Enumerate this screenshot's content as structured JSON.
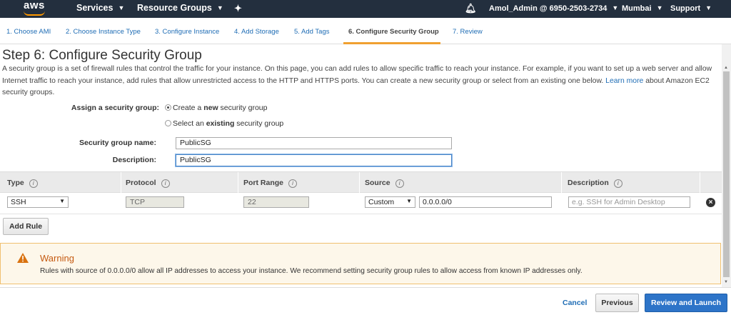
{
  "nav": {
    "logo": "aws",
    "services": "Services",
    "resource_groups": "Resource Groups",
    "account": "Amol_Admin @ 6950-2503-2734",
    "region": "Mumbai",
    "support": "Support"
  },
  "steps": [
    {
      "label": "1. Choose AMI"
    },
    {
      "label": "2. Choose Instance Type"
    },
    {
      "label": "3. Configure Instance"
    },
    {
      "label": "4. Add Storage"
    },
    {
      "label": "5. Add Tags"
    },
    {
      "label": "6. Configure Security Group"
    },
    {
      "label": "7. Review"
    }
  ],
  "page": {
    "title": "Step 6: Configure Security Group",
    "description": "A security group is a set of firewall rules that control the traffic for your instance. On this page, you can add rules to allow specific traffic to reach your instance. For example, if you want to set up a web server and allow Internet traffic to reach your instance, add rules that allow unrestricted access to the HTTP and HTTPS ports. You can create a new security group or select from an existing one below.",
    "learn_more": "Learn more",
    "description_tail": "about Amazon EC2 security groups."
  },
  "form": {
    "assign_label": "Assign a security group:",
    "option_new_pre": "Create a ",
    "option_new_bold": "new",
    "option_new_post": " security group",
    "option_existing_pre": "Select an ",
    "option_existing_bold": "existing",
    "option_existing_post": " security group",
    "name_label": "Security group name:",
    "name_value": "PublicSG",
    "desc_label": "Description:",
    "desc_value": "PublicSG"
  },
  "table": {
    "headers": [
      "Type",
      "Protocol",
      "Port Range",
      "Source",
      "Description"
    ],
    "info_glyph": "i",
    "row": {
      "type": "SSH",
      "protocol": "TCP",
      "port_range": "22",
      "source_mode": "Custom",
      "source_cidr": "0.0.0.0/0",
      "description_placeholder": "e.g. SSH for Admin Desktop"
    },
    "add_rule": "Add Rule"
  },
  "warning": {
    "title": "Warning",
    "message": "Rules with source of 0.0.0.0/0 allow all IP addresses to access your instance. We recommend setting security group rules to allow access from known IP addresses only."
  },
  "footer": {
    "cancel": "Cancel",
    "previous": "Previous",
    "review_launch": "Review and Launch"
  },
  "colors": {
    "nav_bg": "#232f3e",
    "accent": "#ff9900",
    "link": "#1f6db5",
    "primary_button": "#2d74c8",
    "warning_title": "#c55a11"
  }
}
